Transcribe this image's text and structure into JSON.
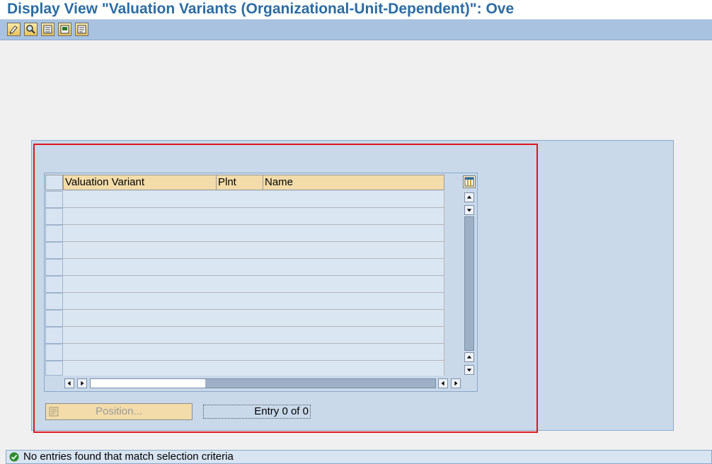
{
  "title": "Display View \"Valuation Variants (Organizational-Unit-Dependent)\": Ove",
  "toolbar": {
    "buttons": [
      {
        "icon": "display-change-icon"
      },
      {
        "icon": "find-icon"
      },
      {
        "icon": "select-all-icon"
      },
      {
        "icon": "select-block-icon"
      },
      {
        "icon": "deselect-all-icon"
      }
    ]
  },
  "table": {
    "columns": [
      "Valuation Variant",
      "Plnt",
      "Name"
    ],
    "rows": [
      [
        "",
        "",
        ""
      ],
      [
        "",
        "",
        ""
      ],
      [
        "",
        "",
        ""
      ],
      [
        "",
        "",
        ""
      ],
      [
        "",
        "",
        ""
      ],
      [
        "",
        "",
        ""
      ],
      [
        "",
        "",
        ""
      ],
      [
        "",
        "",
        ""
      ],
      [
        "",
        "",
        ""
      ],
      [
        "",
        "",
        ""
      ],
      [
        "",
        "",
        ""
      ]
    ]
  },
  "position_button": "Position...",
  "entry_text": "Entry 0 of 0",
  "status": {
    "icon": "success-check-icon",
    "text": "No entries found that match selection criteria"
  },
  "colors": {
    "title": "#2b6ca3",
    "toolbar": "#a8c2e0",
    "panel": "#c9d9ea",
    "header": "#f3dca9",
    "highlight": "#e0161b"
  }
}
